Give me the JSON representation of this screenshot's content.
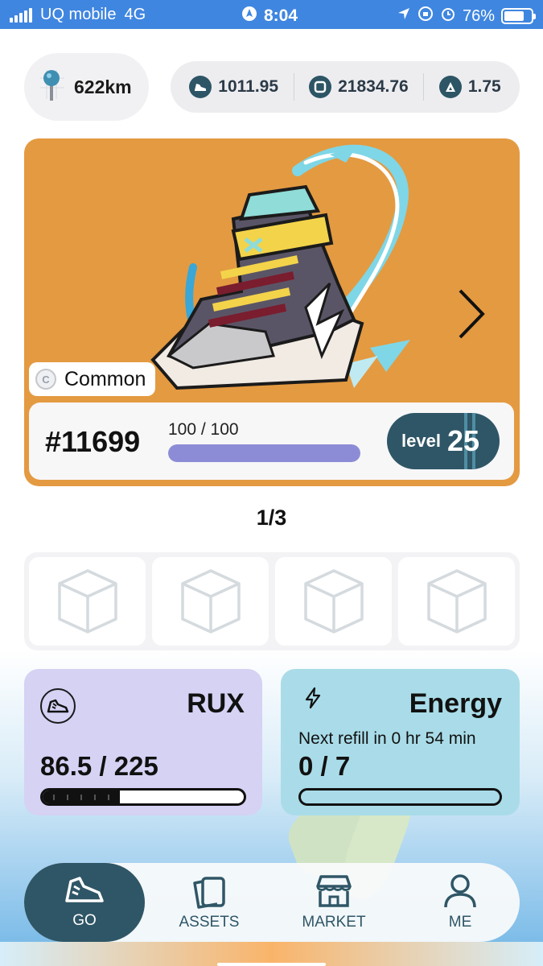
{
  "status_bar": {
    "carrier": "UQ mobile",
    "network": "4G",
    "time": "8:04",
    "battery": "76%",
    "battery_level": 0.76
  },
  "stats": {
    "distance": "622km",
    "tokens": [
      {
        "icon": "sneaker-coin-icon",
        "value": "1011.95"
      },
      {
        "icon": "square-coin-icon",
        "value": "21834.76"
      },
      {
        "icon": "triangle-coin-icon",
        "value": "1.75"
      }
    ]
  },
  "sneaker": {
    "rarity": "Common",
    "rarity_icon_letter": "C",
    "id": "#11699",
    "durability": "100 / 100",
    "durability_fraction": 1.0,
    "level_label": "level",
    "level": "25",
    "card_color": "#e49a41"
  },
  "pager": "1/3",
  "slots": [
    {
      "icon": "box-icon"
    },
    {
      "icon": "box-icon"
    },
    {
      "icon": "box-icon"
    },
    {
      "icon": "box-icon"
    }
  ],
  "rux": {
    "title": "RUX",
    "value": "86.5 / 225",
    "fraction": 0.384,
    "icon": "sneaker-icon"
  },
  "energy": {
    "title": "Energy",
    "refill": "Next refill in 0 hr 54 min",
    "value": "0 / 7",
    "fraction": 0,
    "icon": "lightning-icon"
  },
  "nav": [
    {
      "label": "GO",
      "icon": "sneaker-icon",
      "active": true
    },
    {
      "label": "ASSETS",
      "icon": "cards-icon",
      "active": false
    },
    {
      "label": "MARKET",
      "icon": "store-icon",
      "active": false
    },
    {
      "label": "ME",
      "icon": "person-icon",
      "active": false
    }
  ],
  "colors": {
    "accent": "#2f5666",
    "status_bar": "#3f86e0",
    "rux_card": "#d5d2f4",
    "energy_card": "#a9dce8",
    "durability_fill": "#8c8cd6"
  }
}
